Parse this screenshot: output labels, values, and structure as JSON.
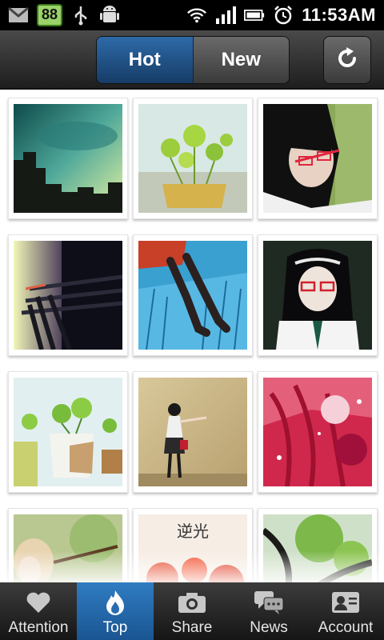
{
  "status_bar": {
    "icons_left": [
      "gmail-icon",
      "badge-88",
      "usb-icon",
      "android-debug-icon"
    ],
    "badge_text": "88",
    "icons_right": [
      "wifi-icon",
      "signal-icon",
      "battery-icon",
      "alarm-icon"
    ],
    "time": "11:53AM"
  },
  "header": {
    "tabs": [
      {
        "label": "Hot",
        "active": true
      },
      {
        "label": "New",
        "active": false
      }
    ],
    "refresh_icon": "refresh-icon"
  },
  "grid": {
    "photos": [
      {
        "name": "city-sky-photo"
      },
      {
        "name": "potted-plant-photo"
      },
      {
        "name": "girl-glasses-photo"
      },
      {
        "name": "railing-sunset-photo"
      },
      {
        "name": "legs-blue-grass-photo"
      },
      {
        "name": "girl-portrait-photo"
      },
      {
        "name": "plant-pot-photo"
      },
      {
        "name": "girl-by-wall-photo"
      },
      {
        "name": "red-hair-photo"
      },
      {
        "name": "blonde-girl-photo"
      },
      {
        "name": "red-flowers-photo",
        "caption": "逆光"
      },
      {
        "name": "tree-branches-photo"
      }
    ]
  },
  "tabbar": {
    "items": [
      {
        "label": "Attention",
        "icon": "heart-icon",
        "active": false
      },
      {
        "label": "Top",
        "icon": "flame-icon",
        "active": true
      },
      {
        "label": "Share",
        "icon": "camera-icon",
        "active": false
      },
      {
        "label": "News",
        "icon": "chat-bubbles-icon",
        "active": false
      },
      {
        "label": "Account",
        "icon": "id-card-icon",
        "active": false
      }
    ]
  },
  "colors": {
    "active_blue": "#1a5591",
    "header_dark": "#1e1e1e",
    "badge_green": "#9bd36a"
  }
}
